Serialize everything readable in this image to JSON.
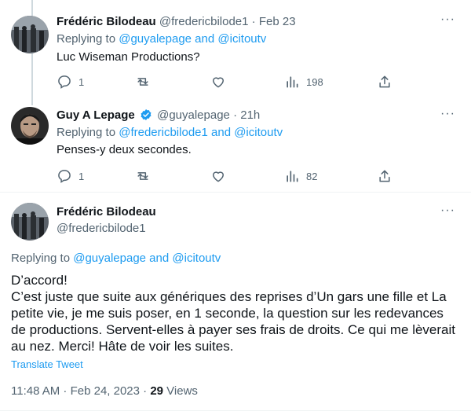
{
  "tweets": [
    {
      "name": "Frédéric Bilodeau",
      "handle": "@fredericbilode1",
      "sep": "·",
      "time": "Feb 23",
      "replying_prefix": "Replying to ",
      "replying_to": "@guyalepage and @icitoutv",
      "text": "Luc Wiseman Productions?",
      "reply_count": "1",
      "views": "198"
    },
    {
      "name": "Guy A Lepage",
      "verified": true,
      "handle": "@guyalepage",
      "sep": "·",
      "time": "21h",
      "replying_prefix": "Replying to ",
      "replying_to": "@fredericbilode1 and @icitoutv",
      "text": "Penses-y deux secondes.",
      "reply_count": "1",
      "views": "82"
    }
  ],
  "main_tweet": {
    "name": "Frédéric Bilodeau",
    "handle": "@fredericbilode1",
    "replying_prefix": "Replying to ",
    "replying_to": "@guyalepage and @icitoutv",
    "line1": "D’accord!",
    "line2": "C’est juste que suite aux génériques des reprises d’Un gars une fille et La petite vie, je me suis poser, en 1 seconde, la question sur les redevances de productions. Servent-elles à payer ses frais de droits. Ce qui me lèverait au nez. Merci! Hâte de voir les suites.",
    "translate_label": "Translate Tweet",
    "timestamp": "11:48 AM · Feb 24, 2023 · ",
    "views_count": "29",
    "views_label": " Views"
  },
  "icons": {
    "more": "more-horizontal-icon",
    "reply": "reply-icon",
    "retweet": "retweet-icon",
    "like": "like-icon",
    "views": "views-icon",
    "share": "share-icon",
    "verified": "verified-badge-icon"
  },
  "colors": {
    "link": "#1d9bf0",
    "muted": "#536471",
    "text": "#0f1419",
    "verified": "#1d9bf0"
  }
}
